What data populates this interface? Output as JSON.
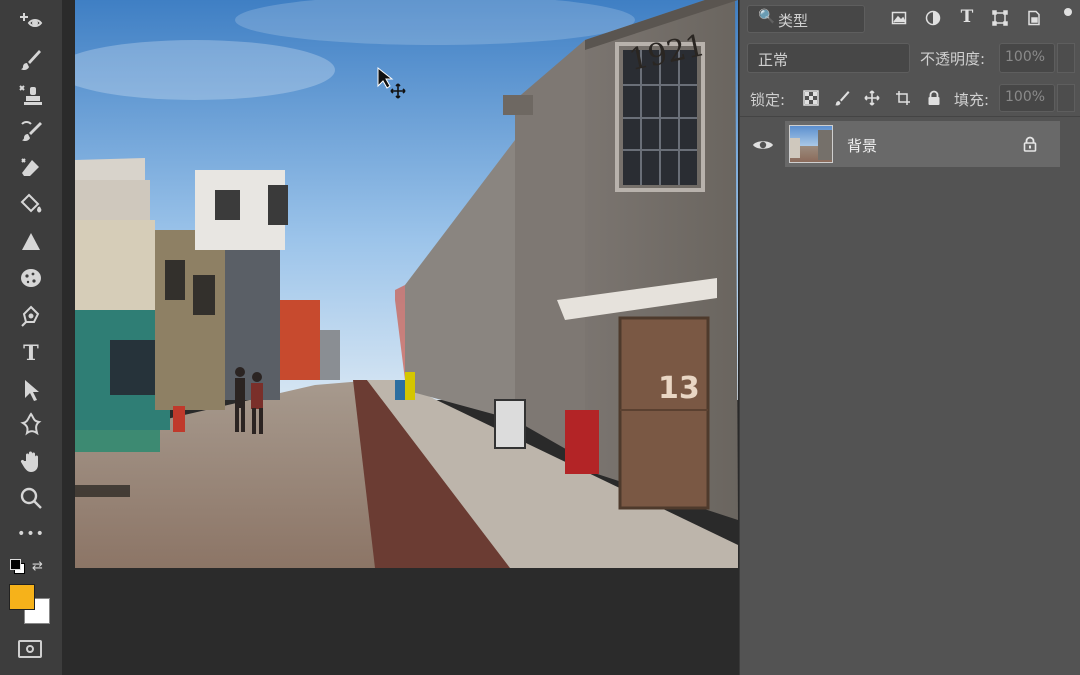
{
  "layers_panel": {
    "filter_kind": "类型",
    "blend_mode": "正常",
    "opacity_label": "不透明度:",
    "opacity_value": "100%",
    "lock_label": "锁定:",
    "fill_label": "填充:",
    "fill_value": "100%",
    "layers": [
      {
        "name": "背景",
        "visible": true,
        "locked": true
      }
    ]
  },
  "toolbar": {
    "tools": [
      "move-tool",
      "brush-tool",
      "clone-stamp-tool",
      "history-brush-tool",
      "eraser-tool",
      "paint-bucket-tool",
      "sharpen-tool",
      "sponge-tool",
      "pen-tool",
      "type-tool",
      "path-selection-tool",
      "custom-shape-tool",
      "hand-tool",
      "zoom-tool",
      "more-tools"
    ],
    "type_tool_glyph": "T",
    "more_glyph": "•••",
    "foreground_color": "#f6b21a",
    "background_color": "#ffffff"
  },
  "photo": {
    "building_number": "1921",
    "door_number": "13"
  },
  "colors": {
    "toolbar_bg": "#3d3d3d",
    "panel_bg": "#535353",
    "selected_layer_bg": "#696969"
  }
}
